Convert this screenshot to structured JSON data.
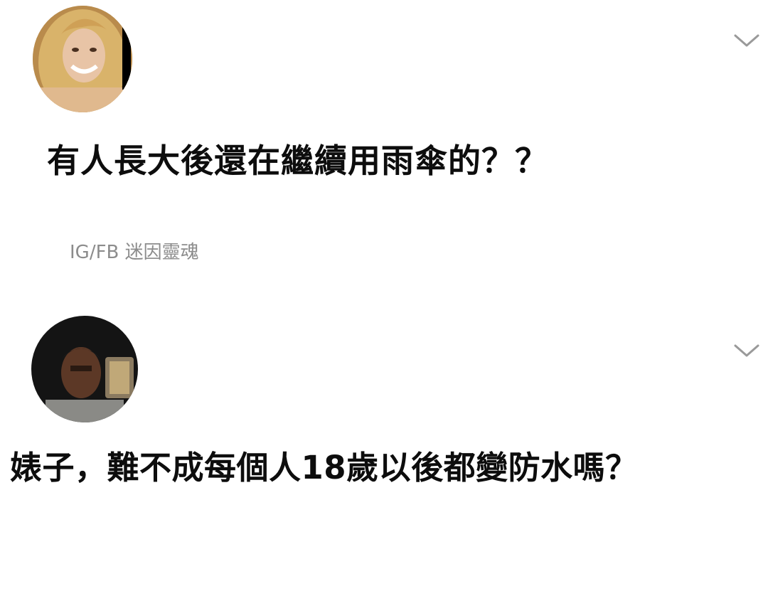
{
  "posts": [
    {
      "avatar_icon": "user-avatar-blonde-woman",
      "menu_icon": "chevron-down-icon",
      "text": "有人長大後還在繼續用雨傘的？？"
    },
    {
      "avatar_icon": "user-avatar-man-selfie",
      "menu_icon": "chevron-down-icon",
      "text": "婊子，難不成每個人18歲以後都變防水嗎？"
    }
  ],
  "watermark": {
    "text": "IG/FB 迷因靈魂"
  }
}
